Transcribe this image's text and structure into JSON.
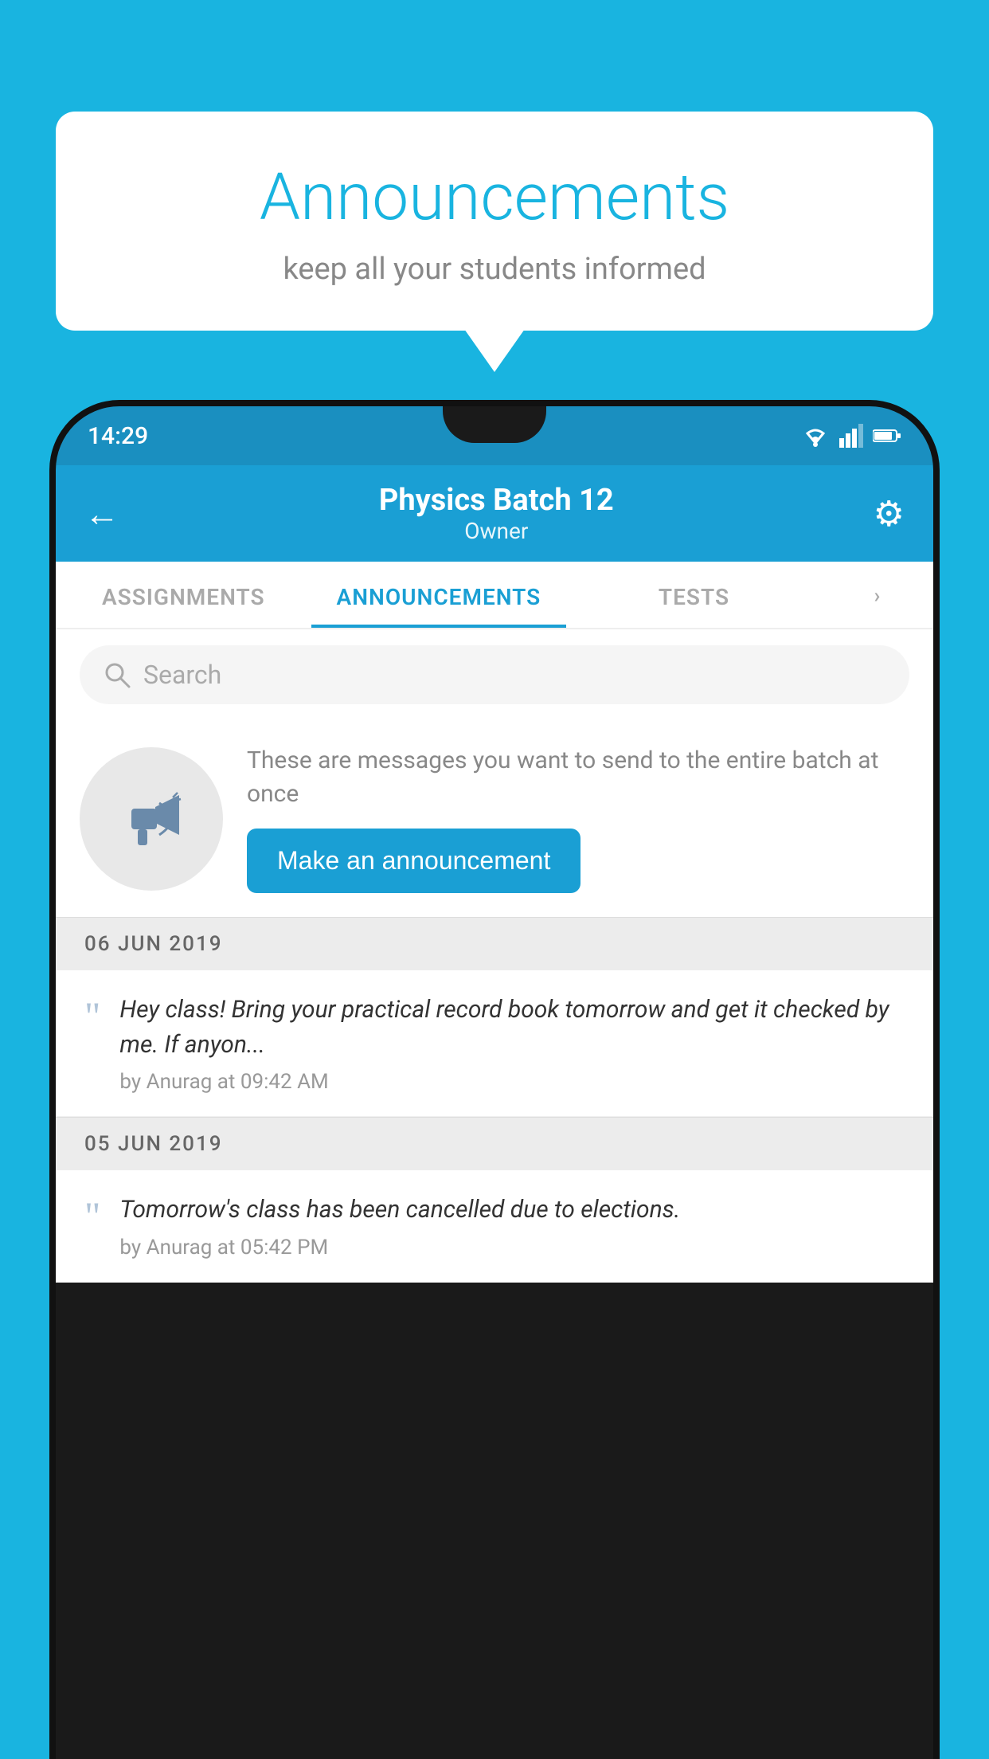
{
  "background_color": "#19b4e0",
  "speech_bubble": {
    "title": "Announcements",
    "subtitle": "keep all your students informed"
  },
  "status_bar": {
    "time": "14:29",
    "icons": [
      "wifi",
      "signal",
      "battery"
    ]
  },
  "app_header": {
    "title": "Physics Batch 12",
    "subtitle": "Owner",
    "back_label": "←",
    "settings_label": "⚙"
  },
  "tabs": [
    {
      "label": "ASSIGNMENTS",
      "active": false
    },
    {
      "label": "ANNOUNCEMENTS",
      "active": true
    },
    {
      "label": "TESTS",
      "active": false
    },
    {
      "label": "MORE",
      "active": false
    }
  ],
  "search": {
    "placeholder": "Search"
  },
  "announce_prompt": {
    "description": "These are messages you want to send to the entire batch at once",
    "button_label": "Make an announcement"
  },
  "date_groups": [
    {
      "date": "06  JUN  2019",
      "announcements": [
        {
          "text": "Hey class! Bring your practical record book tomorrow and get it checked by me. If anyon...",
          "meta": "by Anurag at 09:42 AM"
        }
      ]
    },
    {
      "date": "05  JUN  2019",
      "announcements": [
        {
          "text": "Tomorrow's class has been cancelled due to elections.",
          "meta": "by Anurag at 05:42 PM"
        }
      ]
    }
  ]
}
